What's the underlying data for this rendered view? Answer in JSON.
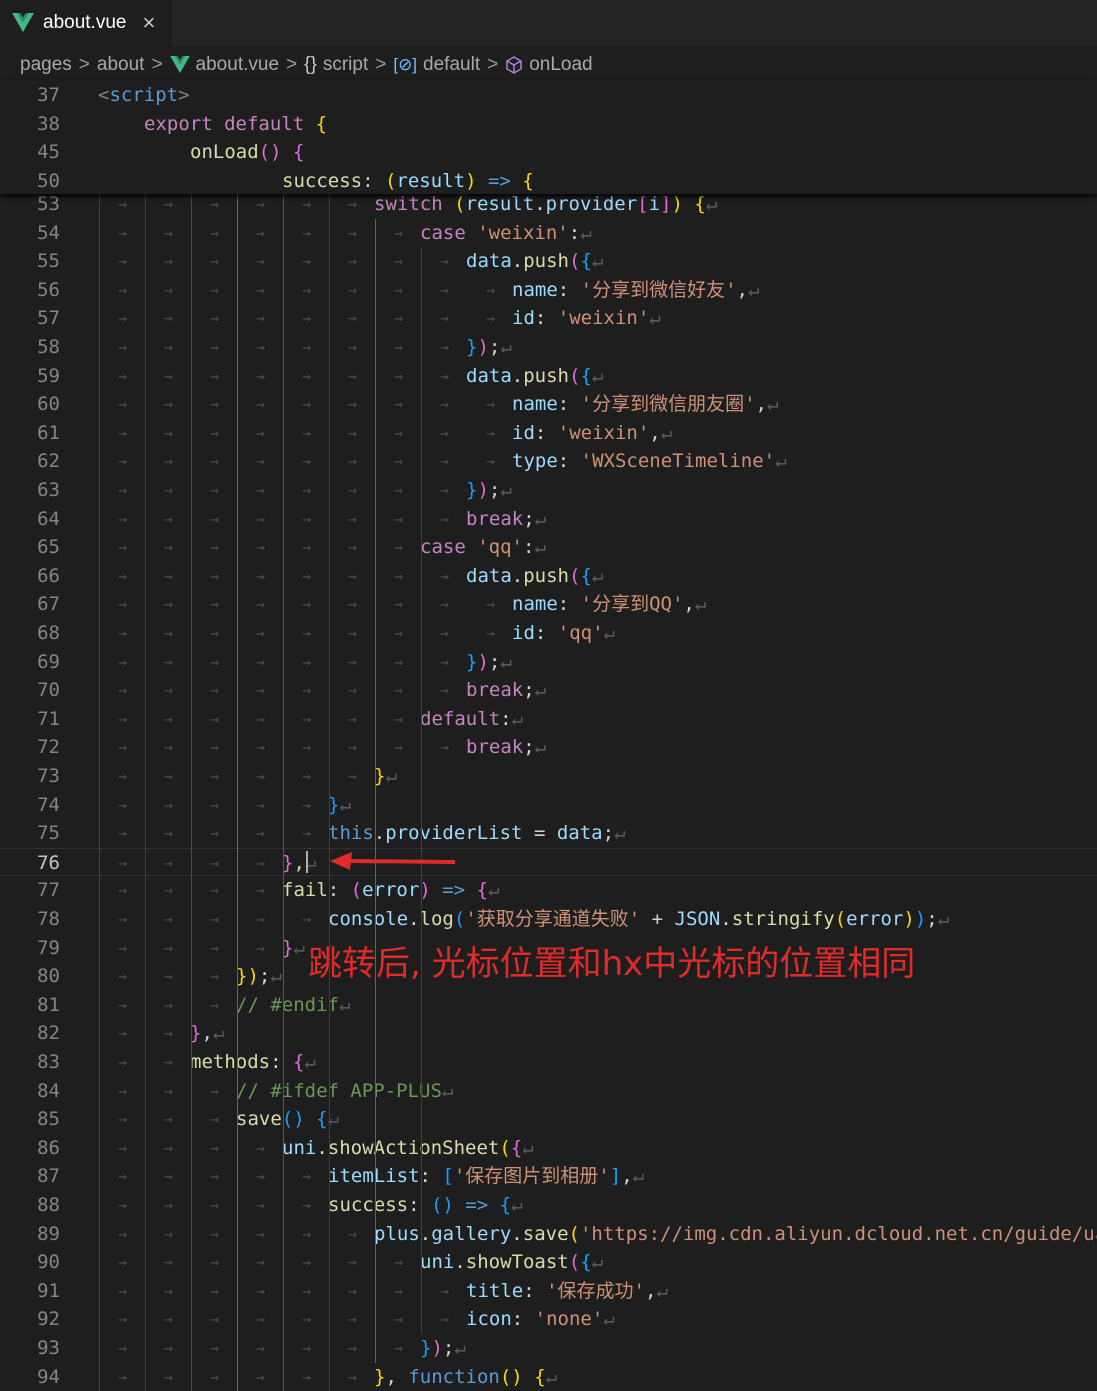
{
  "tab": {
    "title": "about.vue",
    "close": "×",
    "icon": "vue-icon"
  },
  "breadcrumb": {
    "items": [
      "pages",
      "about",
      "about.vue",
      "script",
      "default",
      "onLoad"
    ],
    "separator": ">",
    "icons": {
      "file": "vue-icon",
      "script": "{}",
      "default": "[⊘]",
      "onLoad": "cube-icon"
    }
  },
  "sticky_lines": [
    {
      "n": "37",
      "tokens": [
        [
          "t",
          "<"
        ],
        [
          "t",
          "script"
        ],
        [
          "t",
          ">"
        ]
      ]
    },
    {
      "n": "38",
      "tokens": [
        [
          "c",
          "export"
        ],
        [
          "o",
          " "
        ],
        [
          "c",
          "default"
        ],
        [
          "o",
          " "
        ],
        [
          "b1",
          "{"
        ]
      ]
    },
    {
      "n": "45",
      "tokens": [
        [
          "f",
          "onLoad"
        ],
        [
          "b2",
          "()"
        ],
        [
          "o",
          " "
        ],
        [
          "b2",
          "{"
        ]
      ]
    },
    {
      "n": "50",
      "tokens": [
        [
          "f",
          "success"
        ],
        [
          "o",
          ": "
        ],
        [
          "b1",
          "("
        ],
        [
          "v",
          "result"
        ],
        [
          "b1",
          ")"
        ],
        [
          "o",
          " "
        ],
        [
          "k",
          "=>"
        ],
        [
          "o",
          " "
        ],
        [
          "b1",
          "{"
        ]
      ]
    }
  ],
  "lines": [
    {
      "n": "53",
      "tokens": [
        [
          "c",
          "switch"
        ],
        [
          "o",
          " "
        ],
        [
          "b1",
          "("
        ],
        [
          "v",
          "result"
        ],
        [
          "o",
          "."
        ],
        [
          "v",
          "provider"
        ],
        [
          "b2",
          "["
        ],
        [
          "v",
          "i"
        ],
        [
          "b2",
          "]"
        ],
        [
          "b1",
          ")"
        ],
        [
          "o",
          " "
        ],
        [
          "b1",
          "{"
        ]
      ]
    },
    {
      "n": "54",
      "tokens": [
        [
          "c",
          "case"
        ],
        [
          "o",
          " "
        ],
        [
          "s",
          "'weixin'"
        ],
        [
          "o",
          ":"
        ]
      ]
    },
    {
      "n": "55",
      "tokens": [
        [
          "v",
          "data"
        ],
        [
          "o",
          "."
        ],
        [
          "f",
          "push"
        ],
        [
          "b2",
          "("
        ],
        [
          "b3",
          "{"
        ]
      ]
    },
    {
      "n": "56",
      "tokens": [
        [
          "v",
          "name"
        ],
        [
          "o",
          ": "
        ],
        [
          "s",
          "'分享到微信好友'"
        ],
        [
          "o",
          ","
        ]
      ]
    },
    {
      "n": "57",
      "tokens": [
        [
          "v",
          "id"
        ],
        [
          "o",
          ": "
        ],
        [
          "s",
          "'weixin'"
        ]
      ]
    },
    {
      "n": "58",
      "tokens": [
        [
          "b3",
          "}"
        ],
        [
          "b2",
          ")"
        ],
        [
          "o",
          ";"
        ]
      ]
    },
    {
      "n": "59",
      "tokens": [
        [
          "v",
          "data"
        ],
        [
          "o",
          "."
        ],
        [
          "f",
          "push"
        ],
        [
          "b2",
          "("
        ],
        [
          "b3",
          "{"
        ]
      ]
    },
    {
      "n": "60",
      "tokens": [
        [
          "v",
          "name"
        ],
        [
          "o",
          ": "
        ],
        [
          "s",
          "'分享到微信朋友圈'"
        ],
        [
          "o",
          ","
        ]
      ]
    },
    {
      "n": "61",
      "tokens": [
        [
          "v",
          "id"
        ],
        [
          "o",
          ": "
        ],
        [
          "s",
          "'weixin'"
        ],
        [
          "o",
          ","
        ]
      ]
    },
    {
      "n": "62",
      "tokens": [
        [
          "v",
          "type"
        ],
        [
          "o",
          ": "
        ],
        [
          "s",
          "'WXSceneTimeline'"
        ]
      ]
    },
    {
      "n": "63",
      "tokens": [
        [
          "b3",
          "}"
        ],
        [
          "b2",
          ")"
        ],
        [
          "o",
          ";"
        ]
      ]
    },
    {
      "n": "64",
      "tokens": [
        [
          "c",
          "break"
        ],
        [
          "o",
          ";"
        ]
      ]
    },
    {
      "n": "65",
      "tokens": [
        [
          "c",
          "case"
        ],
        [
          "o",
          " "
        ],
        [
          "s",
          "'qq'"
        ],
        [
          "o",
          ":"
        ]
      ]
    },
    {
      "n": "66",
      "tokens": [
        [
          "v",
          "data"
        ],
        [
          "o",
          "."
        ],
        [
          "f",
          "push"
        ],
        [
          "b2",
          "("
        ],
        [
          "b3",
          "{"
        ]
      ]
    },
    {
      "n": "67",
      "tokens": [
        [
          "v",
          "name"
        ],
        [
          "o",
          ": "
        ],
        [
          "s",
          "'分享到QQ'"
        ],
        [
          "o",
          ","
        ]
      ]
    },
    {
      "n": "68",
      "tokens": [
        [
          "v",
          "id"
        ],
        [
          "o",
          ": "
        ],
        [
          "s",
          "'qq'"
        ]
      ]
    },
    {
      "n": "69",
      "tokens": [
        [
          "b3",
          "}"
        ],
        [
          "b2",
          ")"
        ],
        [
          "o",
          ";"
        ]
      ]
    },
    {
      "n": "70",
      "tokens": [
        [
          "c",
          "break"
        ],
        [
          "o",
          ";"
        ]
      ]
    },
    {
      "n": "71",
      "tokens": [
        [
          "c",
          "default"
        ],
        [
          "o",
          ":"
        ]
      ]
    },
    {
      "n": "72",
      "tokens": [
        [
          "c",
          "break"
        ],
        [
          "o",
          ";"
        ]
      ]
    },
    {
      "n": "73",
      "tokens": [
        [
          "b1",
          "}"
        ]
      ]
    },
    {
      "n": "74",
      "tokens": [
        [
          "b3",
          "}"
        ]
      ]
    },
    {
      "n": "75",
      "tokens": [
        [
          "k",
          "this"
        ],
        [
          "o",
          "."
        ],
        [
          "v",
          "providerList"
        ],
        [
          "o",
          " = "
        ],
        [
          "v",
          "data"
        ],
        [
          "o",
          ";"
        ]
      ]
    },
    {
      "n": "76",
      "tokens": [
        [
          "b2",
          "}"
        ],
        [
          "o",
          ","
        ]
      ]
    },
    {
      "n": "77",
      "tokens": [
        [
          "f",
          "fail"
        ],
        [
          "o",
          ": "
        ],
        [
          "b2",
          "("
        ],
        [
          "v",
          "error"
        ],
        [
          "b2",
          ")"
        ],
        [
          "o",
          " "
        ],
        [
          "k",
          "=>"
        ],
        [
          "o",
          " "
        ],
        [
          "b2",
          "{"
        ]
      ]
    },
    {
      "n": "78",
      "tokens": [
        [
          "v",
          "console"
        ],
        [
          "o",
          "."
        ],
        [
          "f",
          "log"
        ],
        [
          "b3",
          "("
        ],
        [
          "s",
          "'获取分享通道失败'"
        ],
        [
          "o",
          " + "
        ],
        [
          "v",
          "JSON"
        ],
        [
          "o",
          "."
        ],
        [
          "f",
          "stringify"
        ],
        [
          "b1",
          "("
        ],
        [
          "v",
          "error"
        ],
        [
          "b1",
          ")"
        ],
        [
          "b3",
          ")"
        ],
        [
          "o",
          ";"
        ]
      ]
    },
    {
      "n": "79",
      "tokens": [
        [
          "b2",
          "}"
        ]
      ]
    },
    {
      "n": "80",
      "tokens": [
        [
          "b1",
          "}"
        ],
        [
          "b1",
          ")"
        ],
        [
          "o",
          ";"
        ]
      ]
    },
    {
      "n": "81",
      "tokens": [
        [
          "cm",
          "// #endif"
        ]
      ]
    },
    {
      "n": "82",
      "tokens": [
        [
          "b2",
          "}"
        ],
        [
          "o",
          ","
        ]
      ]
    },
    {
      "n": "83",
      "tokens": [
        [
          "f",
          "methods"
        ],
        [
          "o",
          ": "
        ],
        [
          "b2",
          "{"
        ]
      ]
    },
    {
      "n": "84",
      "tokens": [
        [
          "cm",
          "// #ifdef APP-PLUS"
        ]
      ]
    },
    {
      "n": "85",
      "tokens": [
        [
          "f",
          "save"
        ],
        [
          "b3",
          "()"
        ],
        [
          "o",
          " "
        ],
        [
          "b3",
          "{"
        ]
      ]
    },
    {
      "n": "86",
      "tokens": [
        [
          "v",
          "uni"
        ],
        [
          "o",
          "."
        ],
        [
          "f",
          "showActionSheet"
        ],
        [
          "b1",
          "("
        ],
        [
          "b2",
          "{"
        ]
      ]
    },
    {
      "n": "87",
      "tokens": [
        [
          "v",
          "itemList"
        ],
        [
          "o",
          ": "
        ],
        [
          "b3",
          "["
        ],
        [
          "s",
          "'保存图片到相册'"
        ],
        [
          "b3",
          "]"
        ],
        [
          "o",
          ","
        ]
      ]
    },
    {
      "n": "88",
      "tokens": [
        [
          "f",
          "success"
        ],
        [
          "o",
          ": "
        ],
        [
          "b3",
          "()"
        ],
        [
          "o",
          " "
        ],
        [
          "k",
          "=>"
        ],
        [
          "o",
          " "
        ],
        [
          "b3",
          "{"
        ]
      ]
    },
    {
      "n": "89",
      "tokens": [
        [
          "v",
          "plus"
        ],
        [
          "o",
          "."
        ],
        [
          "v",
          "gallery"
        ],
        [
          "o",
          "."
        ],
        [
          "f",
          "save"
        ],
        [
          "b1",
          "("
        ],
        [
          "s",
          "'https://img.cdn.aliyun.dcloud.net.cn/guide/u"
        ]
      ]
    },
    {
      "n": "90",
      "tokens": [
        [
          "v",
          "uni"
        ],
        [
          "o",
          "."
        ],
        [
          "f",
          "showToast"
        ],
        [
          "b2",
          "("
        ],
        [
          "b3",
          "{"
        ]
      ]
    },
    {
      "n": "91",
      "tokens": [
        [
          "v",
          "title"
        ],
        [
          "o",
          ": "
        ],
        [
          "s",
          "'保存成功'"
        ],
        [
          "o",
          ","
        ]
      ]
    },
    {
      "n": "92",
      "tokens": [
        [
          "v",
          "icon"
        ],
        [
          "o",
          ": "
        ],
        [
          "s",
          "'none'"
        ]
      ]
    },
    {
      "n": "93",
      "tokens": [
        [
          "b3",
          "}"
        ],
        [
          "b2",
          ")"
        ],
        [
          "o",
          ";"
        ]
      ]
    },
    {
      "n": "94",
      "tokens": [
        [
          "b1",
          "}"
        ],
        [
          "o",
          ", "
        ],
        [
          "k",
          "function"
        ],
        [
          "b1",
          "()"
        ],
        [
          "o",
          " "
        ],
        [
          "b1",
          "{"
        ]
      ]
    }
  ],
  "current_line": "76",
  "annotation": "跳转后, 光标位置和hx中光标的位置相同",
  "colors": {
    "accent_annotation": "#e02b2b",
    "background": "#1e1e1e"
  }
}
